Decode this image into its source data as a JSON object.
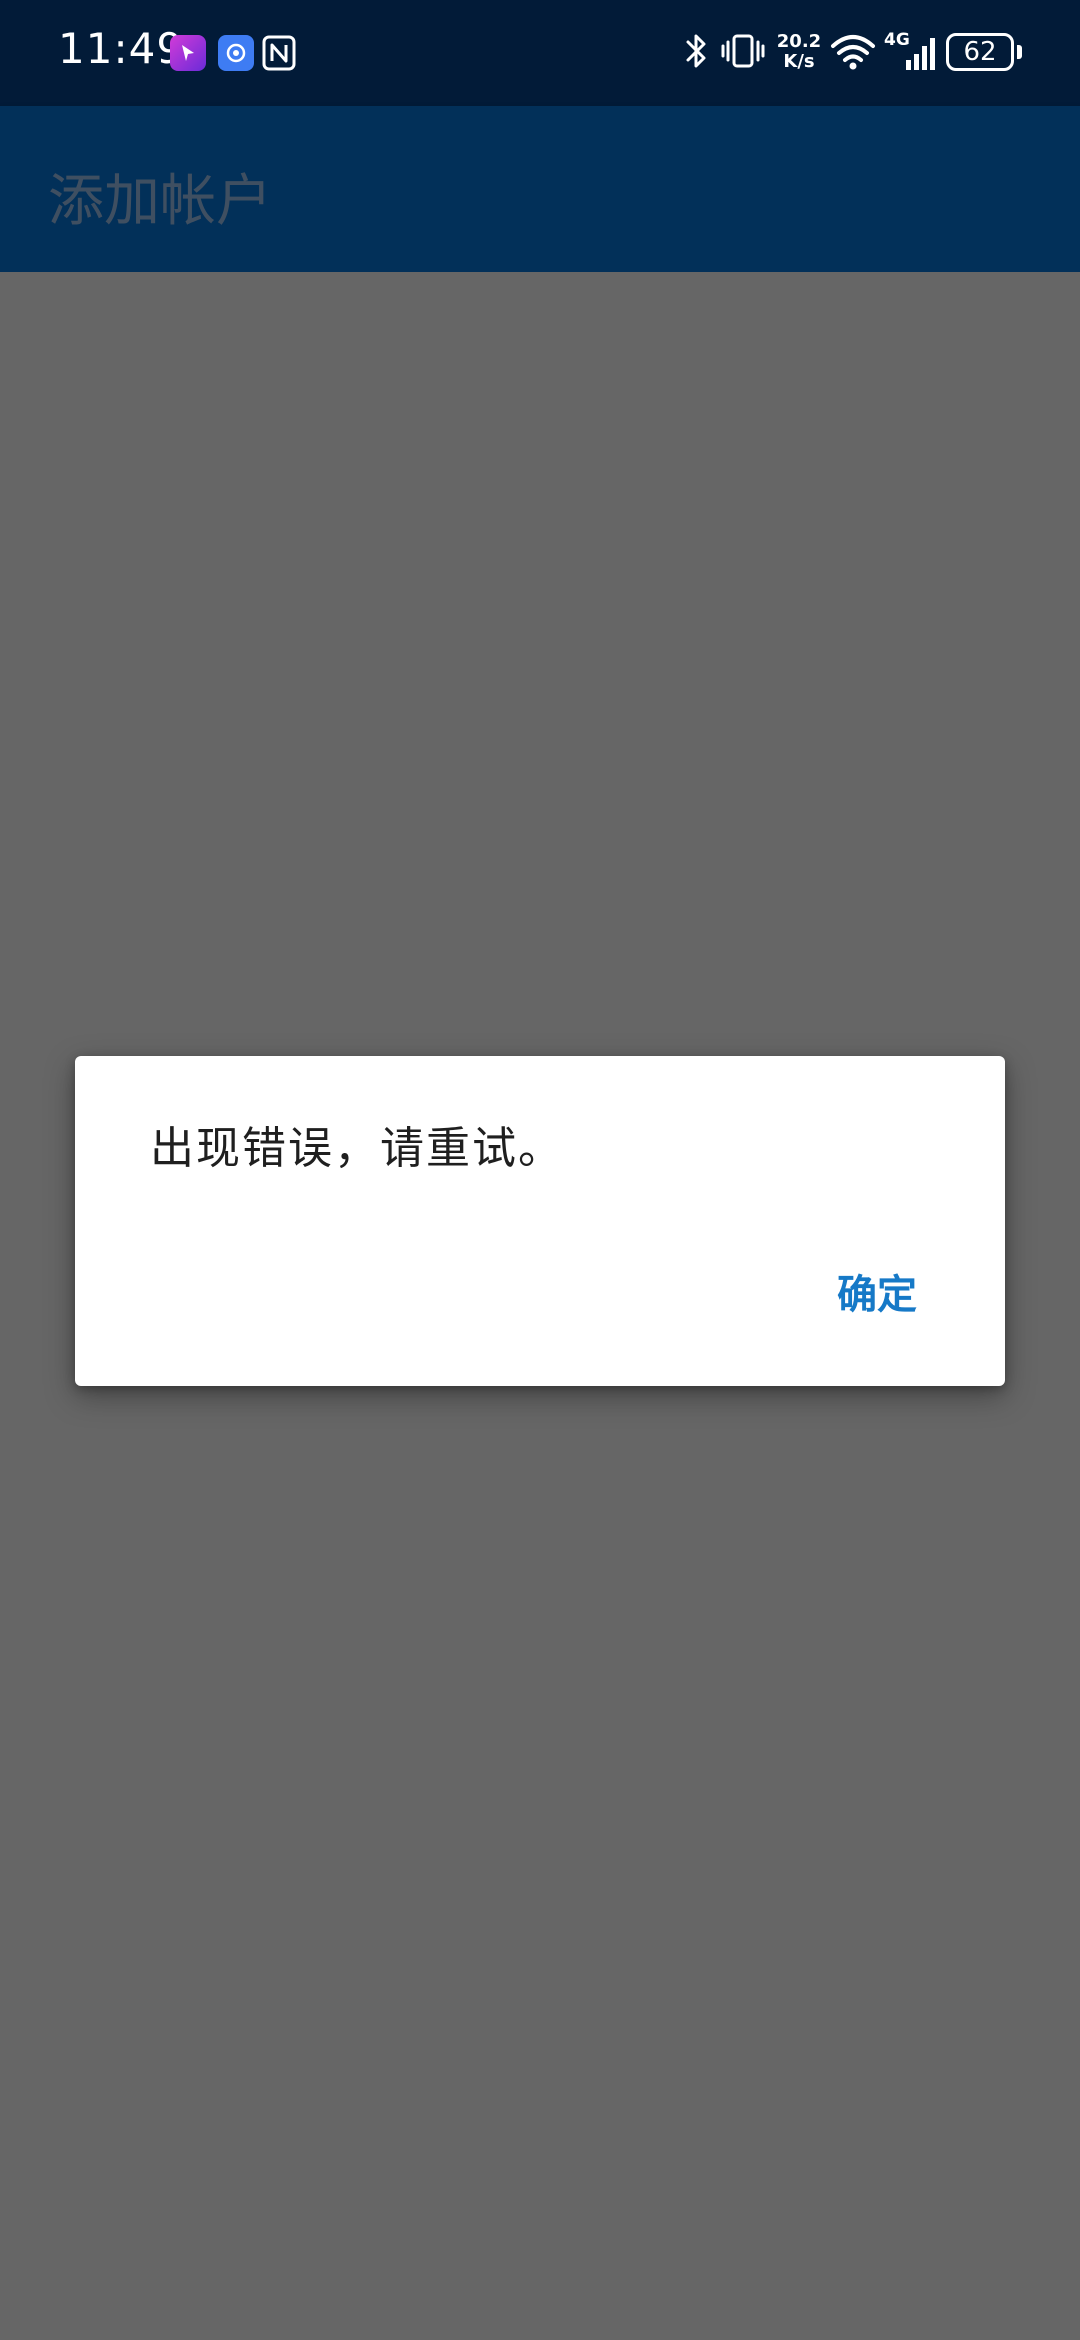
{
  "status_bar": {
    "time": "11:49",
    "net_speed_value": "20.2",
    "net_speed_unit": "K/s",
    "network_type": "4G",
    "battery_level": "62",
    "bg_color": "#021b38",
    "icons": [
      "app-notification-icon",
      "app-notification-icon-2",
      "nfc-icon",
      "bluetooth-icon",
      "vibrate-icon",
      "wifi-icon",
      "signal-icon",
      "battery-icon"
    ]
  },
  "app_bar": {
    "title": "添加帐户",
    "bg_color": "#023059"
  },
  "dialog": {
    "message": "出现错误，请重试。",
    "confirm_label": "确定",
    "accent_color": "#1679c7"
  }
}
